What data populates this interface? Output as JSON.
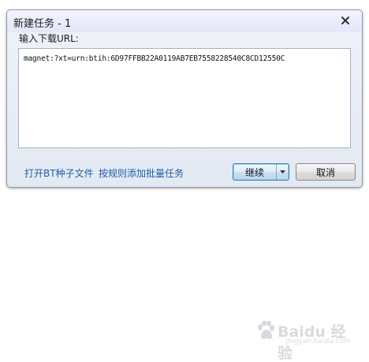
{
  "dialog": {
    "title": "新建任务 - 1",
    "close_icon": "close-icon",
    "url_label": "输入下载URL:",
    "url_value": "magnet:?xt=urn:btih:6D97FFBB22A0119AB7EB7558228540C8CD12550C",
    "links": {
      "open_bt": "打开BT种子文件",
      "batch_add": "按规则添加批量任务"
    },
    "buttons": {
      "continue": "继续",
      "cancel": "取消"
    }
  },
  "watermark": {
    "brand": "Baidu 经验",
    "domain": "jingyan.baidu.com"
  },
  "colors": {
    "link": "#1a5fa8",
    "primary_border": "#3c7fb1"
  }
}
